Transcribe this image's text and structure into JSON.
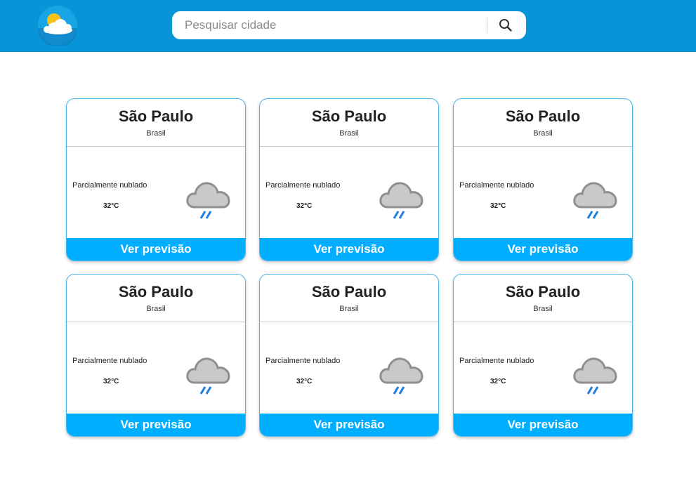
{
  "header": {
    "logo_icon": "sun-cloud-logo-icon",
    "search": {
      "placeholder": "Pesquisar cidade",
      "value": "",
      "button_icon": "search-icon"
    }
  },
  "cards": [
    {
      "city": "São Paulo",
      "country": "Brasil",
      "condition": "Parcialmente nublado",
      "temperature": "32°C",
      "weather_icon": "rain-cloud-icon",
      "button_label": "Ver previsão"
    },
    {
      "city": "São Paulo",
      "country": "Brasil",
      "condition": "Parcialmente nublado",
      "temperature": "32°C",
      "weather_icon": "rain-cloud-icon",
      "button_label": "Ver previsão"
    },
    {
      "city": "São Paulo",
      "country": "Brasil",
      "condition": "Parcialmente nublado",
      "temperature": "32°C",
      "weather_icon": "rain-cloud-icon",
      "button_label": "Ver previsão"
    },
    {
      "city": "São Paulo",
      "country": "Brasil",
      "condition": "Parcialmente nublado",
      "temperature": "32°C",
      "weather_icon": "rain-cloud-icon",
      "button_label": "Ver previsão"
    },
    {
      "city": "São Paulo",
      "country": "Brasil",
      "condition": "Parcialmente nublado",
      "temperature": "32°C",
      "weather_icon": "rain-cloud-icon",
      "button_label": "Ver previsão"
    },
    {
      "city": "São Paulo",
      "country": "Brasil",
      "condition": "Parcialmente nublado",
      "temperature": "32°C",
      "weather_icon": "rain-cloud-icon",
      "button_label": "Ver previsão"
    }
  ],
  "colors": {
    "header_bg": "#0695d6",
    "accent": "#00aeff",
    "card_border": "#49b6f0",
    "rain": "#1e7fe0",
    "cloud": "#9e9e9e"
  }
}
